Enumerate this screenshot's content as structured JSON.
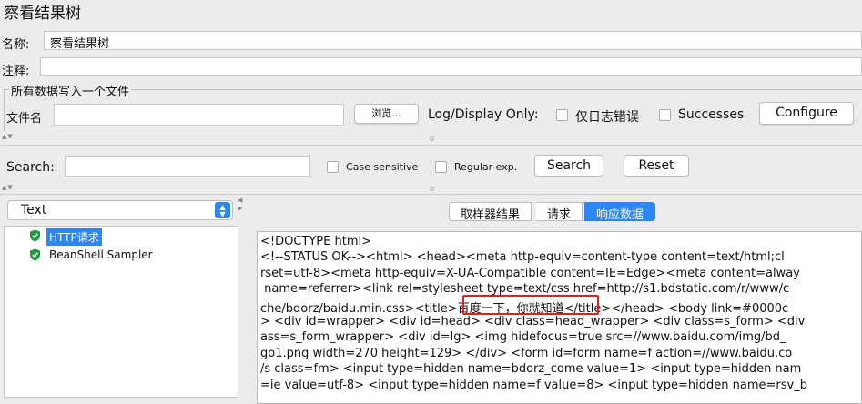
{
  "window": {
    "title": "察看结果树"
  },
  "name": {
    "label": "名称:",
    "value": "察看结果树"
  },
  "comment": {
    "label": "注释:",
    "value": ""
  },
  "file_group": {
    "legend": "所有数据写入一个文件",
    "file_label": "文件名",
    "file_value": "",
    "browse_button": "浏览...",
    "log_display_label": "Log/Display Only:",
    "errors_only_label": "仅日志错误",
    "successes_label": "Successes",
    "configure_button": "Configure"
  },
  "search": {
    "label": "Search:",
    "value": "",
    "case_sensitive_label": "Case sensitive",
    "regular_exp_label": "Regular exp.",
    "search_button": "Search",
    "reset_button": "Reset"
  },
  "renderer": {
    "selected": "Text"
  },
  "tree": {
    "items": [
      {
        "label": "HTTP请求",
        "selected": true,
        "status": "success"
      },
      {
        "label": "BeanShell Sampler",
        "selected": false,
        "status": "success"
      }
    ]
  },
  "tabs": [
    {
      "label": "取样器结果",
      "active": false
    },
    {
      "label": "请求",
      "active": false
    },
    {
      "label": "响应数据",
      "active": true
    }
  ],
  "response": {
    "lines": [
      "<!DOCTYPE html>",
      "<!--STATUS OK--><html> <head><meta http-equiv=content-type content=text/html;cl",
      "rset=utf-8><meta http-equiv=X-UA-Compatible content=IE=Edge><meta content=alway",
      " name=referrer><link rel=stylesheet type=text/css href=http://s1.bdstatic.com/r/www/c",
      "che/bdorz/baidu.min.css><title>百度一下，你就知道</title></head> <body link=#0000c",
      "> <div id=wrapper> <div id=head> <div class=head_wrapper> <div class=s_form> <div",
      "ass=s_form_wrapper> <div id=lg> <img hidefocus=true src=//www.baidu.com/img/bd_",
      "go1.png width=270 height=129> </div> <form id=form name=f action=//www.baidu.co",
      "/s class=fm> <input type=hidden name=bdorz_come value=1> <input type=hidden nam",
      "=ie value=utf-8> <input type=hidden name=f value=8> <input type=hidden name=rsv_b"
    ],
    "highlight_color": "#e02020"
  },
  "colors": {
    "accent": "#2d86f6",
    "success": "#1e9b3a"
  }
}
